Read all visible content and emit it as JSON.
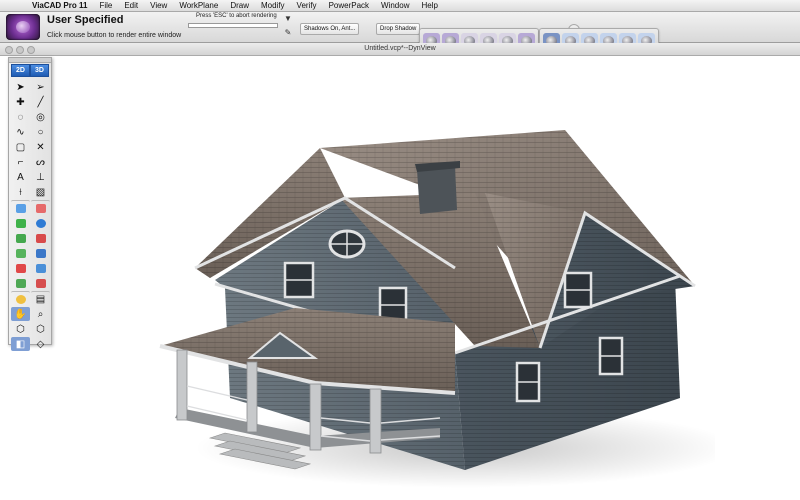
{
  "menubar": {
    "app_name": "ViaCAD Pro 11",
    "items": [
      "File",
      "Edit",
      "View",
      "WorkPlane",
      "Draw",
      "Modify",
      "Verify",
      "PowerPack",
      "Window",
      "Help"
    ]
  },
  "render_bar": {
    "title": "User Specified",
    "hint": "Click mouse button to render entire window",
    "abort_hint": "Press 'ESC' to abort rendering",
    "shadows_option": "Shadows On, Ant...",
    "shadow_option": "Drop Shadow"
  },
  "window": {
    "title": "Untitled.vcp*--DynView"
  },
  "tool_palette": {
    "mode_2d": "2D",
    "mode_3d": "3D",
    "text_tool": "A"
  },
  "palettes": {
    "render_styles": [
      "flat",
      "shaded",
      "outline",
      "hidden",
      "wire",
      "photo"
    ],
    "materials": [
      "camera",
      "blue",
      "gold",
      "mixed",
      "dark",
      "shaded"
    ]
  },
  "colors": {
    "accent": "#1f5cb3",
    "render_purple": "#6b2d8f",
    "siding": "#5b6670",
    "roof": "#7c7066",
    "trim": "#d9dadb"
  }
}
